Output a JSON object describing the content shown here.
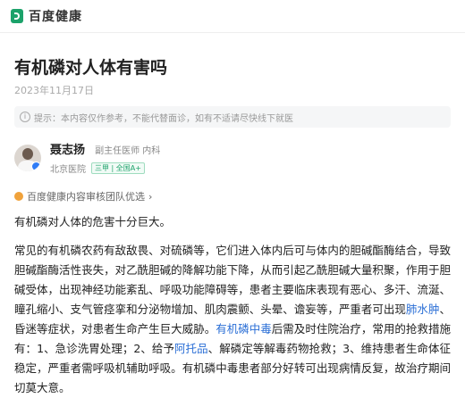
{
  "brand": {
    "name": "百度健康"
  },
  "article": {
    "title": "有机磷对人体有害吗",
    "date": "2023年11月17日",
    "tip": "提示：本内容仅作参考，不能代替面诊，如有不适请尽快线下就医"
  },
  "doctor": {
    "name": "聂志扬",
    "role": "副主任医师 内科",
    "hospital": "北京医院",
    "tag": "三甲 | 全国A+"
  },
  "review": {
    "label": "百度健康内容审核团队优选",
    "arrow": "›"
  },
  "content": {
    "summary": "有机磷对人体的危害十分巨大。",
    "p1": "常见的有机磷农药有敌敌畏、对硫磷等，它们进入体内后可与体内的胆碱酯酶结合，导致胆碱酯酶活性丧失，对乙酰胆碱的降解功能下降，从而引起乙酰胆碱大量积聚，作用于胆碱受体，出现神经功能紊乱、呼吸功能障碍等，患者主要临床表现有恶心、多汗、流涎、瞳孔缩小、支气管痉挛和分泌物增加、肌肉震颤、头晕、谵妄等，严重者可出现",
    "link1": "肺水肿",
    "p2": "、昏迷等症状，对患者生命产生巨大威胁。",
    "link2": "有机磷中毒",
    "p3": "后需及时住院治疗，常用的抢救措施有：1、急诊洗胃处理；2、给予",
    "link3": "阿托品",
    "p4": "、解磷定等解毒药物抢救；3、维持患者生命体征稳定，严重者需呼吸机辅助呼吸。有机磷中毒患者部分好转可出现病情反复，故治疗期间切莫大意。"
  },
  "colors": {
    "brand": "#1ca26a",
    "link": "#2b6fd6"
  },
  "icons": {
    "logo": "baidu-health-logo-icon",
    "tip": "info-icon",
    "review": "badge-icon"
  }
}
